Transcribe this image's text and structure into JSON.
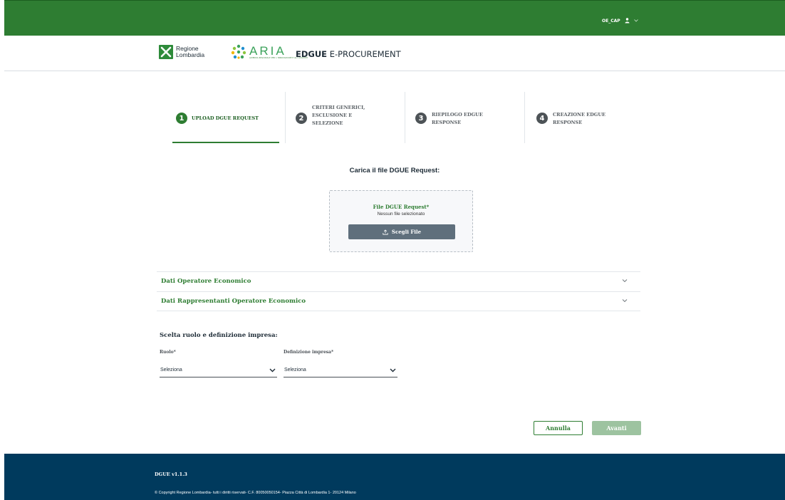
{
  "topbar": {
    "username": "OE_CAP",
    "user_icon": "user-icon",
    "color": "#2e7d32"
  },
  "header": {
    "logo_rl_line1": "Regione",
    "logo_rl_line2": "Lombardia",
    "logo_aria_word": "ARIA",
    "logo_aria_sub": "AZIENDA REGIONALE PER L'INNOVAZIONE E GLI ACQUISTI",
    "brand_bold": "EDGUE",
    "brand_rest": " E-PROCUREMENT"
  },
  "steps": [
    {
      "num": "1",
      "label": "UPLOAD DGUE REQUEST",
      "active": true
    },
    {
      "num": "2",
      "label_lines": [
        "CRITERI GENERICI,",
        "ESCLUSIONE E",
        "SELEZIONE"
      ]
    },
    {
      "num": "3",
      "label_lines": [
        "RIEPILOGO EDGUE",
        "RESPONSE"
      ]
    },
    {
      "num": "4",
      "label_lines": [
        "CREAZIONE EDGUE",
        "RESPONSE"
      ]
    }
  ],
  "upload": {
    "title": "Carica il file DGUE Request:",
    "field_label": "File DGUE Request*",
    "no_file": "Nessun file selezionato",
    "button": "Scegli File",
    "button_icon": "upload-icon"
  },
  "accordions": [
    {
      "title": "Dati Operatore Economico"
    },
    {
      "title": "Dati Rappresentanti Operatore Economico"
    }
  ],
  "role": {
    "title": "Scelta ruolo e definizione impresa:",
    "ruolo_label": "Ruolo*",
    "ruolo_value": "Seleziona",
    "impresa_label": "Definizione impresa*",
    "impresa_value": "Seleziona"
  },
  "actions": {
    "cancel": "Annulla",
    "next": "Avanti"
  },
  "footer": {
    "version": "DGUE v1.1.3",
    "copyright": "© Copyright Regione Lombardia- tutti i diritti riservati- C.F. 80050050154- Piazza Città di Lombardia 1- 20124 Milano",
    "color": "#003a5d"
  }
}
